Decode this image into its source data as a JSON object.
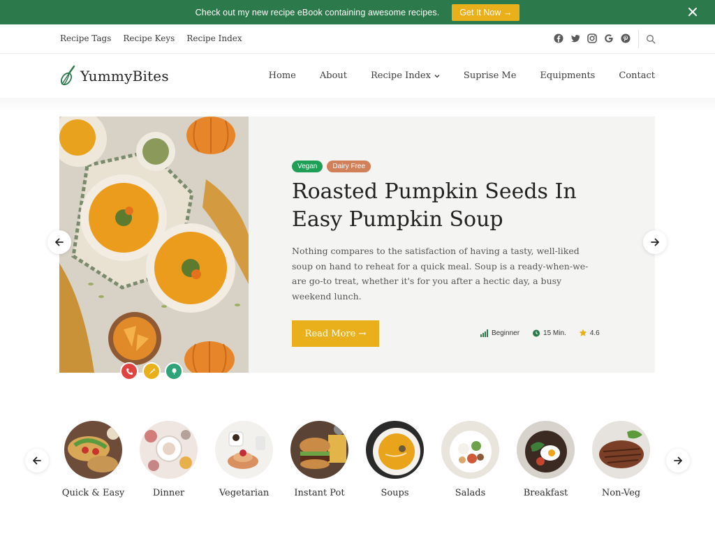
{
  "promo": {
    "text": "Check out my new recipe eBook containing awesome recipes.",
    "button": "Get It Now →"
  },
  "topbar": {
    "links": [
      "Recipe Tags",
      "Recipe Keys",
      "Recipe Index"
    ],
    "socials": [
      "facebook-icon",
      "twitter-icon",
      "instagram-icon",
      "google-icon",
      "pinterest-icon"
    ]
  },
  "brand": {
    "name": "YummyBites"
  },
  "nav": {
    "items": [
      "Home",
      "About",
      "Recipe Index",
      "Suprise Me",
      "Equipments",
      "Contact"
    ]
  },
  "hero": {
    "tags": [
      "Vegan",
      "Dairy Free"
    ],
    "title": "Roasted Pumpkin Seeds In Easy Pumpkin Soup",
    "description": "Nothing compares to the satisfaction of having a tasty, well-liked soup on hand to reheat for a quick meal. Soup is a ready-when-we-are go-to treat, whether it's for you after a hectic day, a busy weekend lunch.",
    "button": "Read More →",
    "difficulty": "Beginner",
    "time": "15 Min.",
    "rating": "4.6"
  },
  "categories": [
    {
      "label": "Quick & Easy"
    },
    {
      "label": "Dinner"
    },
    {
      "label": "Vegetarian"
    },
    {
      "label": "Instant Pot"
    },
    {
      "label": "Soups"
    },
    {
      "label": "Salads"
    },
    {
      "label": "Breakfast"
    },
    {
      "label": "Non-Veg"
    }
  ],
  "colors": {
    "brand_green": "#2c7a4b",
    "accent_yellow": "#eab01c",
    "tag_vegan": "#1e9e57",
    "tag_dairy": "#d2805a"
  }
}
